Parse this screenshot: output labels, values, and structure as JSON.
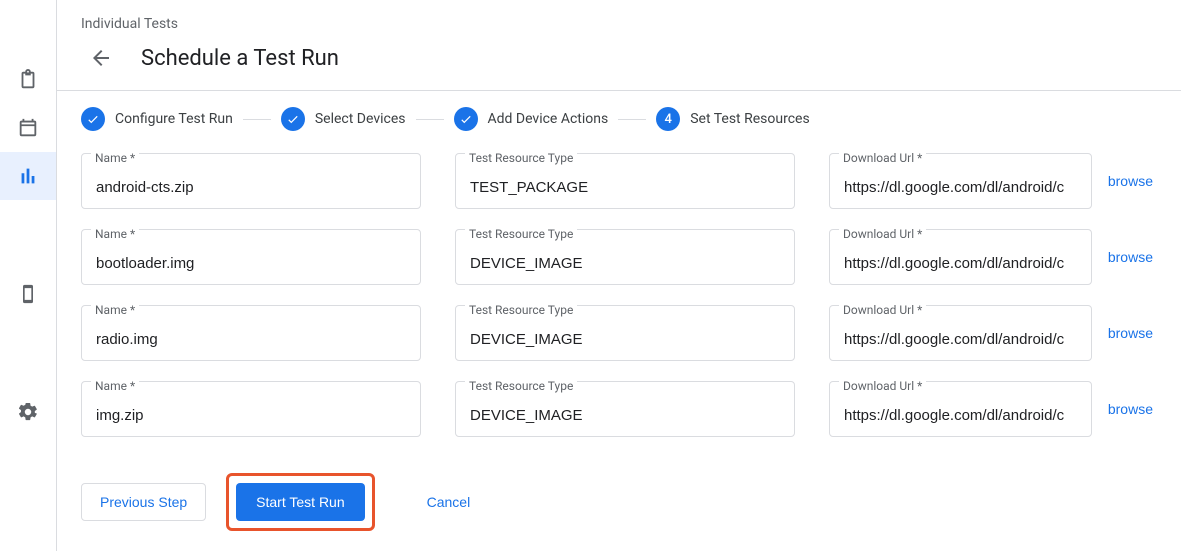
{
  "header": {
    "breadcrumb": "Individual Tests",
    "title": "Schedule a Test Run"
  },
  "stepper": {
    "s1": "Configure Test Run",
    "s2": "Select Devices",
    "s3": "Add Device Actions",
    "s4": "Set Test Resources",
    "current_number": "4"
  },
  "labels": {
    "name": "Name *",
    "type": "Test Resource Type",
    "url": "Download Url *",
    "browse": "browse"
  },
  "resources": [
    {
      "name": "android-cts.zip",
      "type": "TEST_PACKAGE",
      "url": "https://dl.google.com/dl/android/c"
    },
    {
      "name": "bootloader.img",
      "type": "DEVICE_IMAGE",
      "url": "https://dl.google.com/dl/android/c"
    },
    {
      "name": "radio.img",
      "type": "DEVICE_IMAGE",
      "url": "https://dl.google.com/dl/android/c"
    },
    {
      "name": "img.zip",
      "type": "DEVICE_IMAGE",
      "url": "https://dl.google.com/dl/android/c"
    }
  ],
  "footer": {
    "previous": "Previous Step",
    "start": "Start Test Run",
    "cancel": "Cancel"
  }
}
